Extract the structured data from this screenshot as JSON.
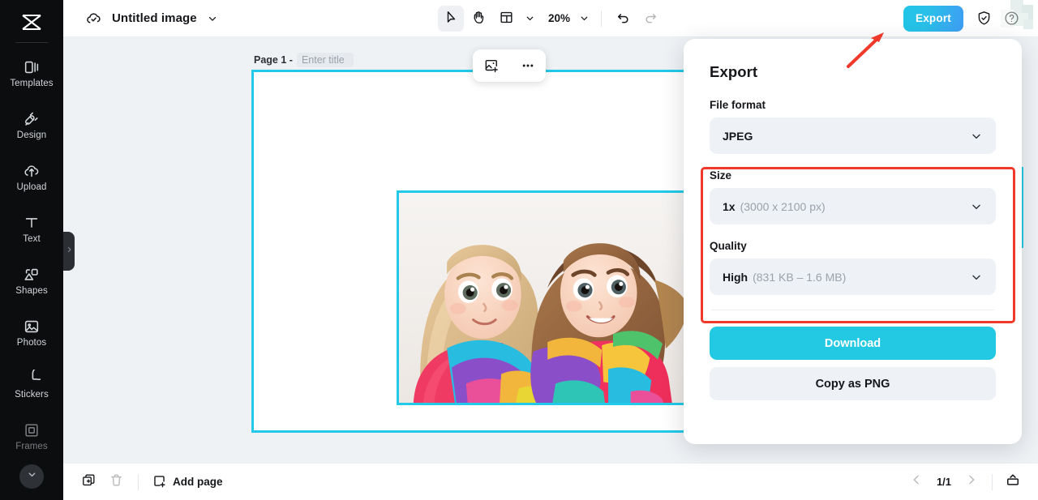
{
  "app": {
    "logo_icon": "capcut-logo-icon",
    "cloud_icon": "cloud-saved-icon",
    "document_title": "Untitled image",
    "title_caret_icon": "chevron-down-icon"
  },
  "toolbar": {
    "select_tool_icon": "cursor-arrow-icon",
    "hand_tool_icon": "hand-icon",
    "layout_tool_icon": "layout-grid-icon",
    "layout_caret_icon": "chevron-down-icon",
    "zoom_level": "20%",
    "zoom_caret_icon": "chevron-down-icon",
    "undo_icon": "undo-arrow-icon",
    "redo_icon": "redo-arrow-icon",
    "export_label": "Export",
    "shield_icon": "shield-check-icon",
    "help_icon": "question-circle-icon"
  },
  "sidebar": {
    "items": [
      {
        "label": "Templates",
        "icon": "templates-icon"
      },
      {
        "label": "Design",
        "icon": "design-icon"
      },
      {
        "label": "Upload",
        "icon": "upload-cloud-icon"
      },
      {
        "label": "Text",
        "icon": "text-t-icon"
      },
      {
        "label": "Shapes",
        "icon": "shapes-icon"
      },
      {
        "label": "Photos",
        "icon": "photo-image-icon"
      },
      {
        "label": "Stickers",
        "icon": "sticker-icon"
      },
      {
        "label": "Frames",
        "icon": "frame-icon"
      }
    ],
    "expand_icon": "chevron-down-circle-icon",
    "panel_handle_icon": "chevron-right-icon"
  },
  "canvas": {
    "page_label": "Page 1 -",
    "page_title_value": "",
    "page_title_placeholder": "Enter title",
    "float_toolbar": {
      "add_image_icon": "add-image-icon",
      "more_icon": "more-horizontal-icon"
    },
    "selection_color": "#22c9e8",
    "background_color": "#eff2f5"
  },
  "export_panel": {
    "title": "Export",
    "file_format_label": "File format",
    "file_format_value": "JPEG",
    "size_label": "Size",
    "size_value": "1x",
    "size_detail": "(3000 x 2100 px)",
    "quality_label": "Quality",
    "quality_value": "High",
    "quality_detail": "(831 KB – 1.6 MB)",
    "download_label": "Download",
    "copy_label": "Copy as PNG",
    "chevron_icon": "chevron-down-icon",
    "download_color": "#23c8e2"
  },
  "annotations": {
    "highlight_color": "#f0392b",
    "arrow_icon": "arrow-up-right-icon",
    "highlight_target": "size-and-quality-section",
    "arrow_target": "export-button"
  },
  "bottombar": {
    "duplicate_icon": "duplicate-page-icon",
    "delete_icon": "trash-icon",
    "add_page_icon": "add-page-icon",
    "add_page_label": "Add page",
    "prev_icon": "chevron-left-icon",
    "page_indicator": "1/1",
    "next_icon": "chevron-right-icon",
    "present_icon": "present-icon"
  }
}
